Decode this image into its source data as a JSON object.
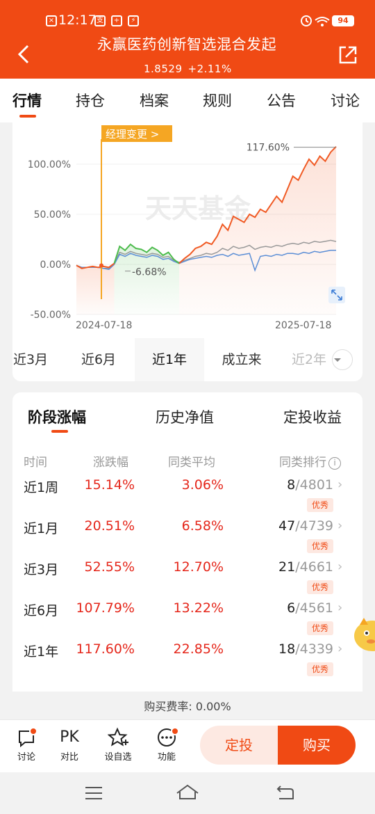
{
  "status_bar": {
    "time": "12:17",
    "battery": "94"
  },
  "header": {
    "title": "永赢医药创新智选混合发起",
    "nav": "1.8529",
    "change": "+2.11%"
  },
  "tabs": [
    "行情",
    "持仓",
    "档案",
    "规则",
    "公告",
    "讨论"
  ],
  "chart": {
    "manager_change_label": "经理变更",
    "peak_label": "117.60%",
    "low_label": "-6.68%",
    "watermark": "天天基金",
    "y_ticks": [
      "100.00%",
      "50.00%",
      "0.00%",
      "-50.00%"
    ],
    "x_start": "2024-07-18",
    "x_end": "2025-07-18"
  },
  "chart_data": {
    "type": "line",
    "x_labels": [
      "2024-07-18",
      "2025-07-18"
    ],
    "ylim": [
      -50,
      117.6
    ],
    "y_ticks": [
      100,
      50,
      0,
      -50
    ],
    "annotations": [
      {
        "text": "经理变更"
      },
      {
        "text": "117.60%",
        "value": 117.6
      },
      {
        "text": "-6.68%",
        "value": -6.68
      }
    ],
    "series": [
      {
        "color": "#f05a24",
        "values": [
          -1,
          -4,
          -3,
          -2,
          -3,
          -2,
          -3,
          1,
          18,
          14,
          20,
          16,
          15,
          12,
          17,
          14,
          9,
          12,
          5,
          1,
          6,
          10,
          16,
          18,
          22,
          20,
          28,
          40,
          34,
          48,
          45,
          42,
          50,
          47,
          55,
          52,
          60,
          68,
          62,
          75,
          88,
          84,
          95,
          105,
          99,
          108,
          103,
          112,
          117.6
        ]
      },
      {
        "color": "#999999",
        "values": [
          -1,
          -3,
          -3,
          -3,
          -3,
          -4,
          -4,
          1,
          12,
          10,
          13,
          11,
          10,
          9,
          11,
          10,
          7,
          8,
          4,
          2,
          4,
          6,
          8,
          9,
          11,
          10,
          12,
          16,
          14,
          18,
          16,
          17,
          19,
          15,
          17,
          18,
          17,
          19,
          18,
          20,
          21,
          20,
          22,
          21,
          23,
          22,
          23,
          24,
          22.85
        ]
      },
      {
        "color": "#5b8ed6",
        "values": [
          -1,
          -3,
          -3,
          -3,
          -3,
          -4,
          -5,
          0,
          10,
          8,
          11,
          9,
          8,
          7,
          9,
          8,
          5,
          6,
          3,
          1,
          3,
          5,
          6,
          7,
          8,
          7,
          9,
          10,
          8,
          11,
          9,
          10,
          11,
          -6,
          8,
          9,
          8,
          10,
          9,
          11,
          11,
          10,
          12,
          11,
          13,
          12,
          13,
          14,
          14
        ]
      }
    ]
  },
  "ranges": [
    "近3月",
    "近6月",
    "近1年",
    "成立来",
    "近2年"
  ],
  "perf": {
    "tabs": [
      "阶段涨幅",
      "历史净值",
      "定投收益"
    ],
    "headers": [
      "时间",
      "涨跌幅",
      "同类平均",
      "同类排行"
    ],
    "rows": [
      {
        "period": "近1周",
        "change": "15.14%",
        "avg": "3.06%",
        "rank": "8",
        "total": "/4801",
        "badge": "优秀"
      },
      {
        "period": "近1月",
        "change": "20.51%",
        "avg": "6.58%",
        "rank": "47",
        "total": "/4739",
        "badge": "优秀"
      },
      {
        "period": "近3月",
        "change": "52.55%",
        "avg": "12.70%",
        "rank": "21",
        "total": "/4661",
        "badge": "优秀"
      },
      {
        "period": "近6月",
        "change": "107.79%",
        "avg": "13.22%",
        "rank": "6",
        "total": "/4561",
        "badge": "优秀"
      },
      {
        "period": "近1年",
        "change": "117.60%",
        "avg": "22.85%",
        "rank": "18",
        "total": "/4339",
        "badge": "优秀"
      }
    ]
  },
  "fee": "购买费率: 0.00%",
  "bottom": {
    "items": [
      {
        "icon": "chat-icon",
        "label": "讨论"
      },
      {
        "icon": "pk-icon",
        "glyph": "PK",
        "label": "对比"
      },
      {
        "icon": "star-add-icon",
        "label": "设自选"
      },
      {
        "icon": "more-icon",
        "label": "功能"
      }
    ],
    "sip_label": "定投",
    "buy_label": "购买"
  },
  "colors": {
    "brand": "#f04a14",
    "up": "#e5271b",
    "fund_line": "#f05a24",
    "avg_line": "#999999",
    "index_line": "#5b8ed6",
    "manager_line": "#f5a623"
  }
}
